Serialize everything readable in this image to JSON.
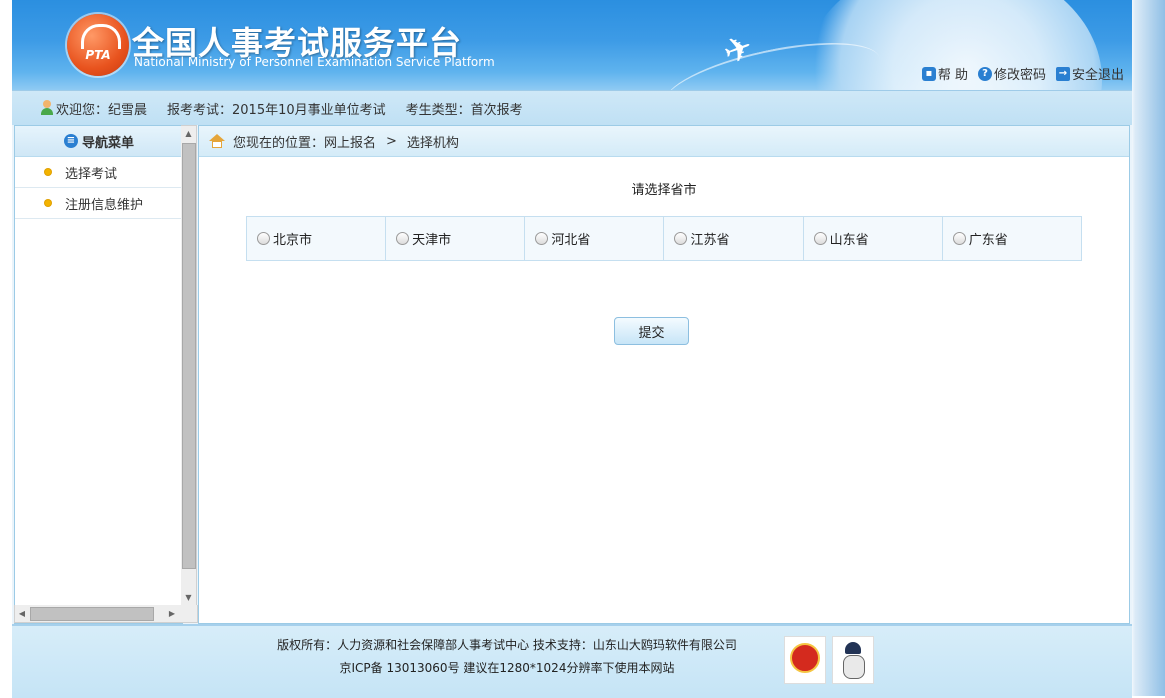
{
  "header": {
    "title": "全国人事考试服务平台",
    "subtitle": "National Ministry of Personnel Examination Service Platform",
    "logo_text": "PTA",
    "links": [
      {
        "label": "帮 助",
        "icon": "lock-icon"
      },
      {
        "label": "修改密码",
        "icon": "help-icon"
      },
      {
        "label": "安全退出",
        "icon": "exit-icon"
      }
    ]
  },
  "infobar": {
    "welcome": "欢迎您：纪雪晨",
    "exam": "报考考试：2015年10月事业单位考试",
    "candidate_type": "考生类型：首次报考"
  },
  "sidebar": {
    "title": "导航菜单",
    "items": [
      {
        "label": "选择考试"
      },
      {
        "label": "注册信息维护"
      }
    ]
  },
  "breadcrumb": {
    "prefix": "您现在的位置：网上报名",
    "separator": ">",
    "current": "选择机构"
  },
  "main": {
    "prompt": "请选择省市",
    "provinces": [
      "北京市",
      "天津市",
      "河北省",
      "江苏省",
      "山东省",
      "广东省"
    ],
    "submit_label": "提交"
  },
  "footer": {
    "line1": "版权所有：人力资源和社会保障部人事考试中心   技术支持：山东山大鸥玛软件有限公司",
    "line2": "京ICP备 13013060号   建议在1280*1024分辨率下使用本网站"
  },
  "colors": {
    "header_blue": "#2b8fe0",
    "accent_light": "#cfe8f7",
    "logo_orange": "#e8531e"
  }
}
